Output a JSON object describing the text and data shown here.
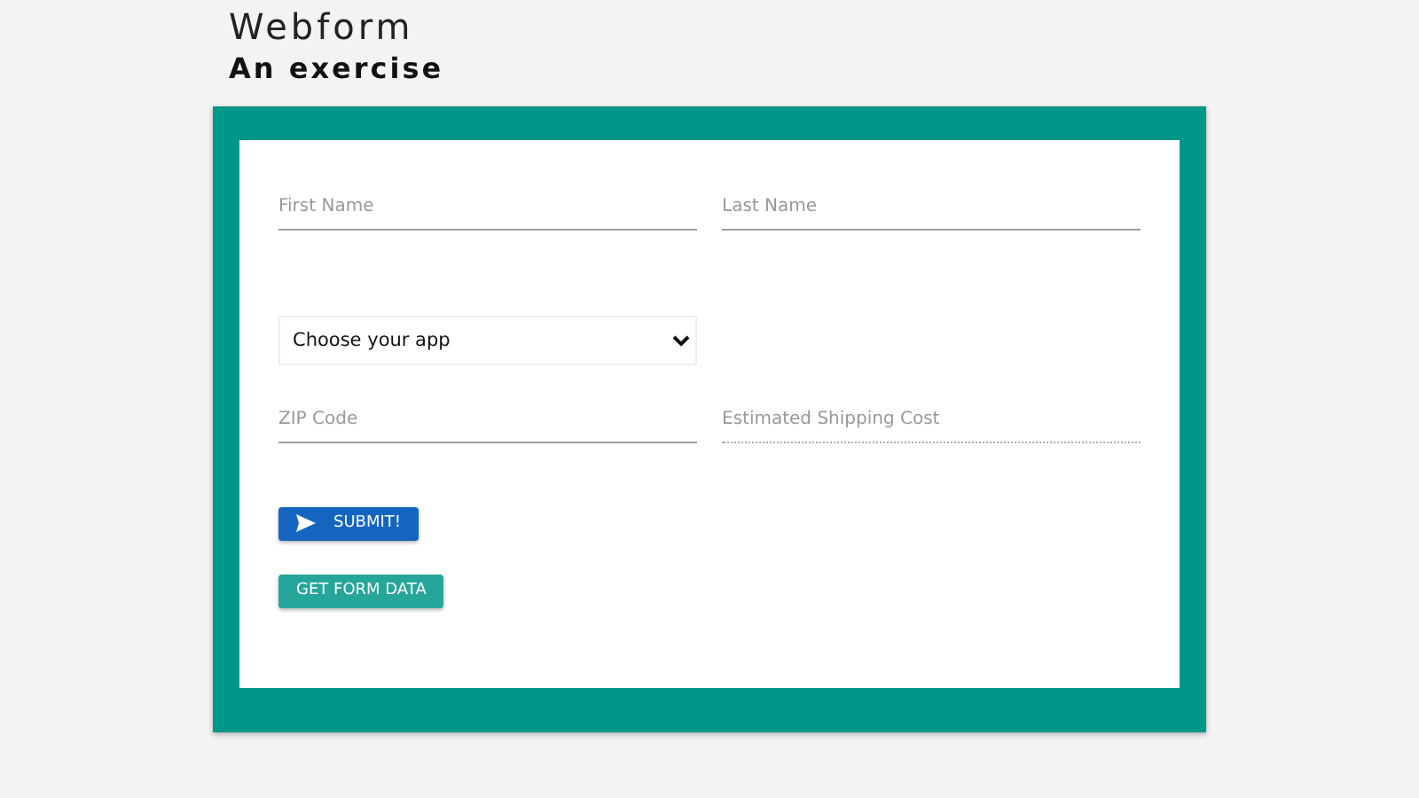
{
  "header": {
    "title": "Webform",
    "subtitle": "An exercise"
  },
  "form": {
    "rows": [
      {
        "kind": "text",
        "fields": [
          {
            "placeholder": "First Name",
            "disabled": false
          },
          {
            "placeholder": "Last Name",
            "disabled": false
          }
        ]
      },
      {
        "kind": "select",
        "fields": [
          {
            "value": "Choose your app",
            "disabled": false
          }
        ]
      },
      {
        "kind": "text",
        "fields": [
          {
            "placeholder": "ZIP Code",
            "disabled": false
          },
          {
            "placeholder": "Estimated Shipping Cost",
            "disabled": true
          }
        ]
      }
    ],
    "buttons": [
      {
        "label": "SUBMIT!",
        "kind": "primary"
      },
      {
        "label": "GET FORM DATA",
        "kind": "secondary"
      }
    ]
  }
}
